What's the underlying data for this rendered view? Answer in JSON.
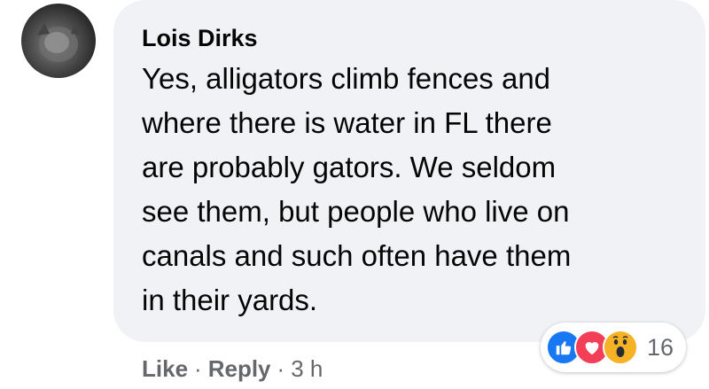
{
  "comment": {
    "author": "Lois Dirks",
    "lines": [
      "Yes, alligators climb fences and",
      "where there is water in FL there",
      "are probably gators. We seldom",
      "see them, but people who live on",
      "canals and such often have them",
      "in their yards."
    ],
    "reactions": {
      "icons": [
        "like-icon",
        "love-icon",
        "wow-icon"
      ],
      "count": "16",
      "colors": {
        "like": "#1877f2",
        "love": "#f33e58",
        "wow": "#f7b125"
      }
    },
    "actions": {
      "like_label": "Like",
      "separator": "·",
      "reply_label": "Reply",
      "timestamp": "3 h"
    }
  },
  "theme": {
    "bubble_bg": "#f0f2f5",
    "text": "#050505",
    "secondary_text": "#65676b"
  }
}
